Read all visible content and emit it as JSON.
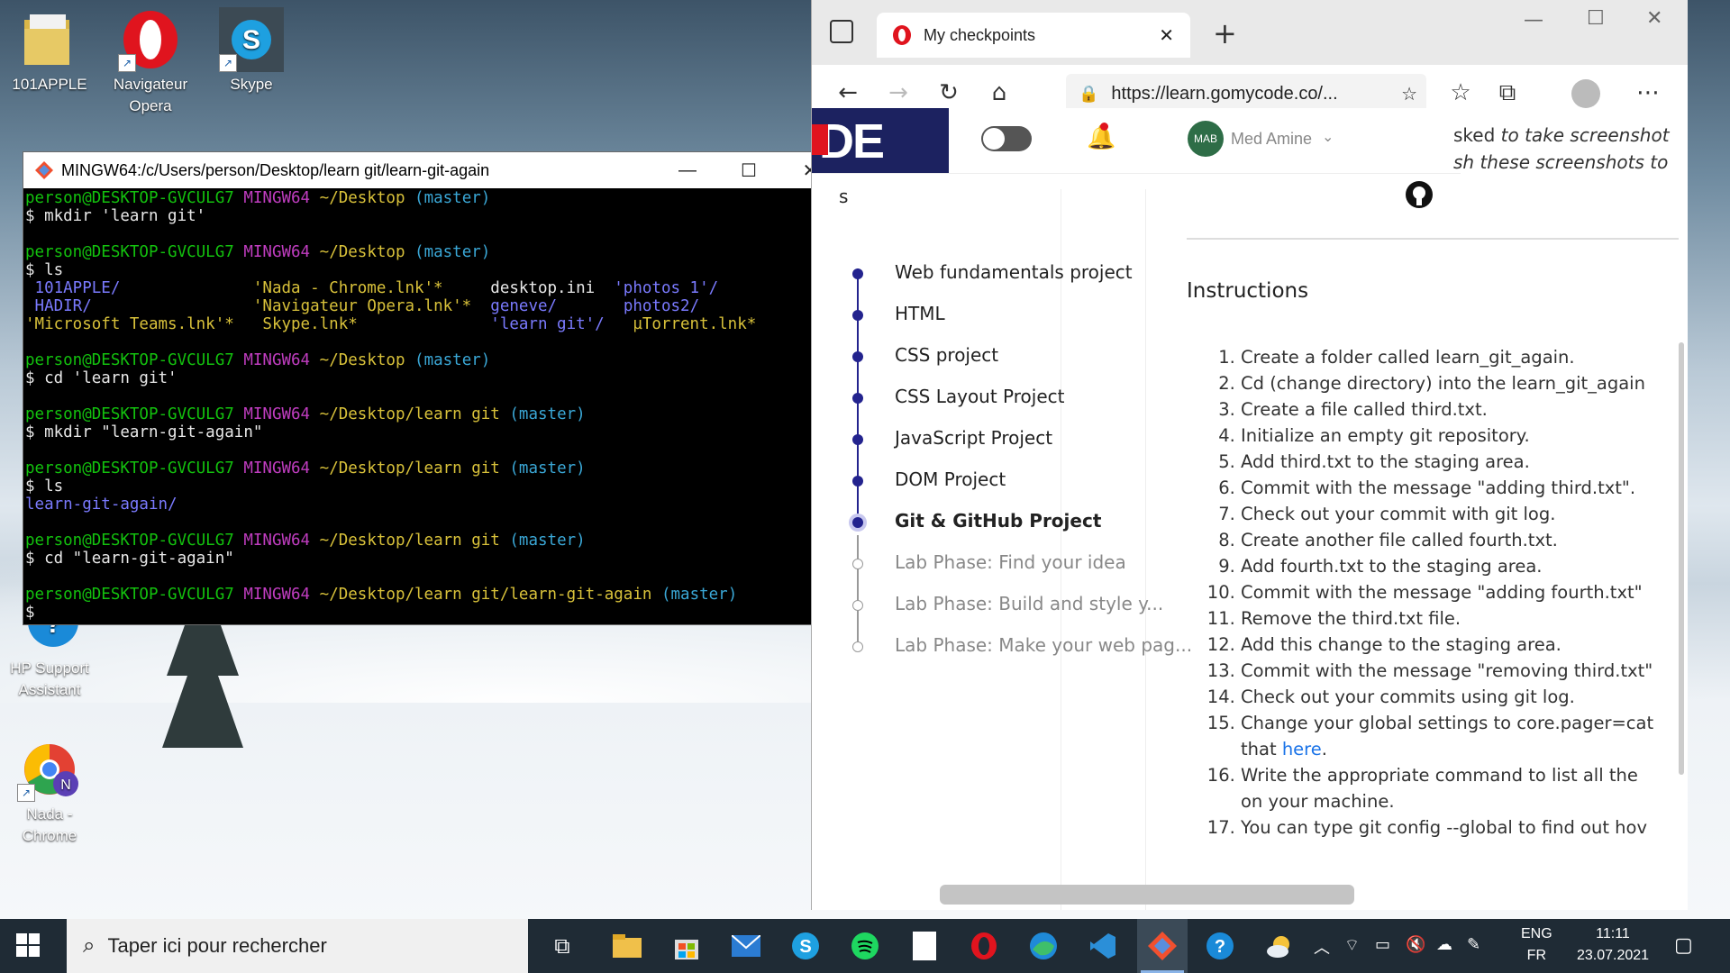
{
  "desktop": {
    "icons": [
      {
        "label": "101APPLE"
      },
      {
        "label": "Navigateur Opera"
      },
      {
        "label": "Skype"
      },
      {
        "label": "HP Support Assistant"
      },
      {
        "label": "Nada - Chrome"
      }
    ]
  },
  "terminal": {
    "title": "MINGW64:/c/Users/person/Desktop/learn git/learn-git-again",
    "user": "person@DESKTOP-GVCULG7",
    "shell": "MINGW64",
    "blocks": [
      {
        "path": "~/Desktop",
        "branch": "(master)",
        "cmd": "$ mkdir 'learn git'"
      },
      {
        "path": "~/Desktop",
        "branch": "(master)",
        "cmd": "$ ls"
      },
      {
        "path": "~/Desktop",
        "branch": "(master)",
        "cmd": "$ cd 'learn git'"
      },
      {
        "path": "~/Desktop/learn git",
        "branch": "(master)",
        "cmd": "$ mkdir \"learn-git-again\""
      },
      {
        "path": "~/Desktop/learn git",
        "branch": "(master)",
        "cmd": "$ ls"
      },
      {
        "path": "~/Desktop/learn git",
        "branch": "(master)",
        "cmd": "$ cd \"learn-git-again\""
      },
      {
        "path": "~/Desktop/learn git/learn-git-again",
        "branch": "(master)",
        "cmd": "$"
      }
    ],
    "ls1": {
      "r1c1": " 101APPLE/",
      "r1c2": "'Nada - Chrome.lnk'*",
      "r1c3": "desktop.ini",
      "r1c4": "'photos 1'/",
      "r2c1": " HADIR/",
      "r2c2": "'Navigateur Opera.lnk'*",
      "r2c3": "geneve/",
      "r2c4": "photos2/",
      "r3c1": "'Microsoft Teams.lnk'*",
      "r3c2": "Skype.lnk*",
      "r3c3": "'learn git'/",
      "r3c4": "µTorrent.lnk*"
    },
    "ls2": "learn-git-again/"
  },
  "browser": {
    "tab_title": "My checkpoints",
    "url": "https://learn.gomycode.co/...",
    "user_name": "Med Amine",
    "avatar": "MAB",
    "logo": "DE",
    "partial_1": "sked",
    "partial_1b": "to take screenshot",
    "partial_2": "sh these screenshots to",
    "partial_s": "s",
    "sidebar": [
      {
        "label": "Web fundamentals project",
        "state": "done"
      },
      {
        "label": "HTML",
        "state": "done"
      },
      {
        "label": "CSS project",
        "state": "done"
      },
      {
        "label": "CSS Layout Project",
        "state": "done"
      },
      {
        "label": "JavaScript Project",
        "state": "done"
      },
      {
        "label": "DOM Project",
        "state": "done"
      },
      {
        "label": "Git & GitHub Project",
        "state": "current"
      },
      {
        "label": "Lab Phase: Find your idea",
        "state": "locked"
      },
      {
        "label": "Lab Phase: Build and style y...",
        "state": "locked"
      },
      {
        "label": "Lab Phase: Make your web pag...",
        "state": "locked"
      }
    ],
    "instructions_title": "Instructions",
    "steps": [
      "Create a folder called learn_git_again.",
      "Cd (change directory) into the learn_git_again",
      "Create a file called third.txt.",
      "Initialize an empty git repository.",
      "Add third.txt to the staging area.",
      "Commit with the message \"adding third.txt\".",
      "Check out your commit with git log.",
      "Create another file called fourth.txt.",
      "Add fourth.txt to the staging area.",
      "Commit with the message \"adding fourth.txt\"",
      "Remove the third.txt file.",
      "Add this change to the staging area.",
      "Commit with the message \"removing third.txt\"",
      "Check out your commits using git log.",
      "Change your global settings to core.pager=cat",
      "Write the appropriate  command to list all the",
      "You can type git config --global to find out hov"
    ],
    "step15_cont": "that ",
    "step15_link": "here",
    "step15_end": ".",
    "step16_cont": "on your machine."
  },
  "taskbar": {
    "search_placeholder": "Taper ici pour rechercher",
    "lang_top": "ENG",
    "lang_bottom": "FR",
    "time": "11:11",
    "date": "23.07.2021"
  }
}
